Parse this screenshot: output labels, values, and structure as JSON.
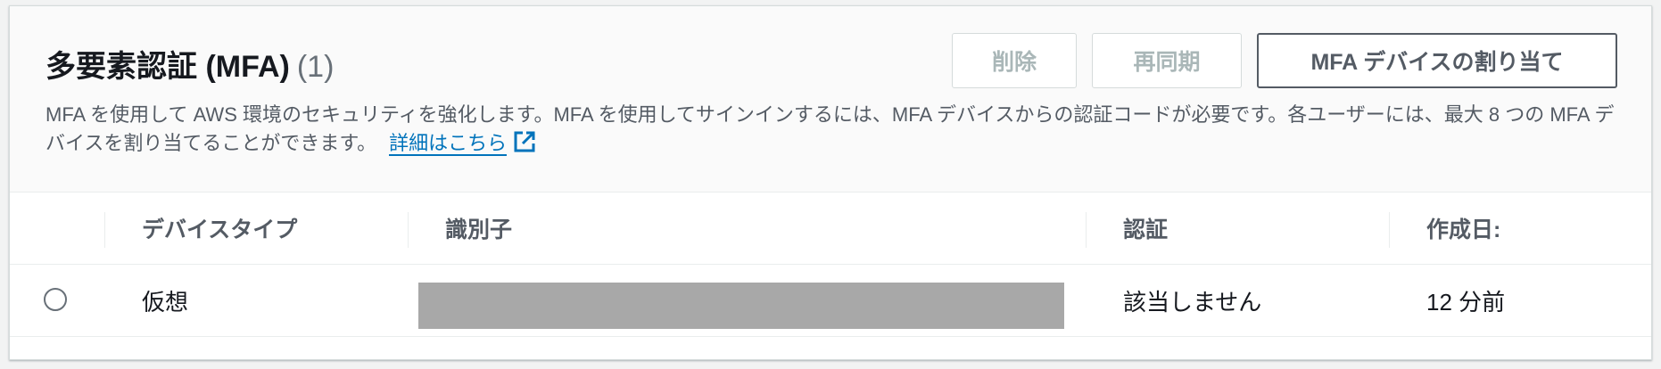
{
  "header": {
    "title": "多要素認証 (MFA)",
    "count": "(1)",
    "description": "MFA を使用して AWS 環境のセキュリティを強化します。MFA を使用してサインインするには、MFA デバイスからの認証コードが必要です。各ユーザーには、最大 8 つの MFA デバイスを割り当てることができます。",
    "learn_more_link": "詳細はこちら"
  },
  "actions": {
    "delete_label": "削除",
    "resync_label": "再同期",
    "assign_label": "MFA デバイスの割り当て"
  },
  "table": {
    "columns": [
      "デバイスタイプ",
      "識別子",
      "認証",
      "作成日:"
    ],
    "rows": [
      {
        "device_type": "仮想",
        "identifier_redacted": true,
        "certification": "該当しません",
        "created": "12 分前"
      }
    ]
  },
  "colors": {
    "accent_link": "#0073bb",
    "header_bg": "#fafafa",
    "disabled_text": "#aab7b8",
    "redaction": "#a8a8a8"
  },
  "icons": {
    "external_link": "external-link-icon",
    "row_select": "radio-button"
  }
}
